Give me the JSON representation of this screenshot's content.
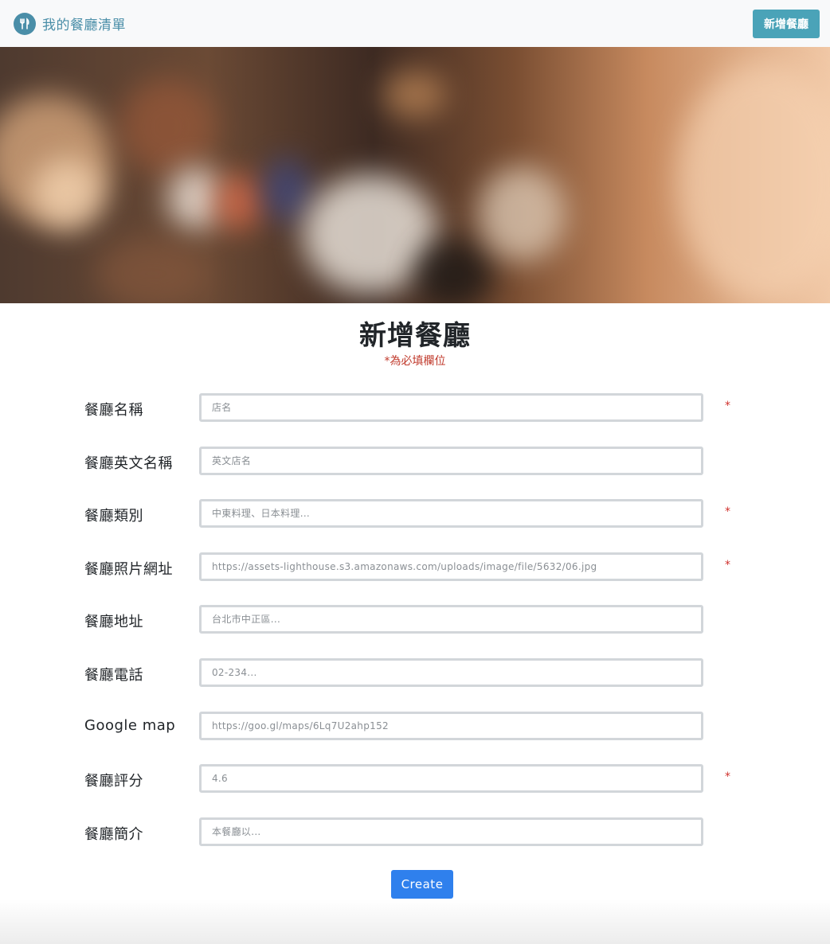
{
  "navbar": {
    "brand_icon": "utensils-icon",
    "brand_text": "我的餐廳清單",
    "new_button_label": "新增餐廳"
  },
  "page": {
    "title": "新增餐廳",
    "required_note": "*為必填欄位"
  },
  "form": {
    "fields": [
      {
        "label": "餐廳名稱",
        "placeholder": "店名",
        "required": true
      },
      {
        "label": "餐廳英文名稱",
        "placeholder": "英文店名",
        "required": false
      },
      {
        "label": "餐廳類別",
        "placeholder": "中東料理、日本料理...",
        "required": true
      },
      {
        "label": "餐廳照片網址",
        "placeholder": "https://assets-lighthouse.s3.amazonaws.com/uploads/image/file/5632/06.jpg",
        "required": true
      },
      {
        "label": "餐廳地址",
        "placeholder": "台北市中正區...",
        "required": false
      },
      {
        "label": "餐廳電話",
        "placeholder": "02-234...",
        "required": false
      },
      {
        "label": "Google map",
        "placeholder": "https://goo.gl/maps/6Lq7U2ahp152",
        "required": false
      },
      {
        "label": "餐廳評分",
        "placeholder": "4.6",
        "required": true
      },
      {
        "label": "餐廳簡介",
        "placeholder": "本餐廳以...",
        "required": false
      }
    ],
    "required_mark": "*",
    "submit_label": "Create"
  }
}
